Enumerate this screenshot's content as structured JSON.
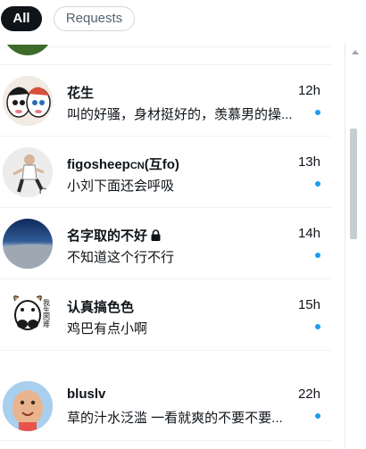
{
  "tabs": {
    "all_label": "All",
    "requests_label": "Requests"
  },
  "colors": {
    "unread_dot": "#1d9bf0",
    "active_tab_bg": "#0f1419"
  },
  "conversations": [
    {
      "name": "花生",
      "time": "12h",
      "message": "叫的好骚，身材挺好的，羡慕男的操...",
      "unread": true
    },
    {
      "name": "figosheep",
      "name_suffix": "CN",
      "name_tail": "(互fo)",
      "time": "13h",
      "message": "小刘下面还会呼吸",
      "unread": true
    },
    {
      "name": "名字取的不好",
      "locked": true,
      "lock_icon": "lock-icon",
      "time": "14h",
      "message": "不知道这个行不行",
      "unread": true
    },
    {
      "name": "认真搞色色",
      "avatar_text": "我\n生\n困\n难",
      "time": "15h",
      "message": "鸡巴有点小啊",
      "unread": true
    },
    {
      "name": "bluslv",
      "time": "22h",
      "message": "草的汁水泛滥   一看就爽的不要不要...",
      "unread": true
    }
  ]
}
